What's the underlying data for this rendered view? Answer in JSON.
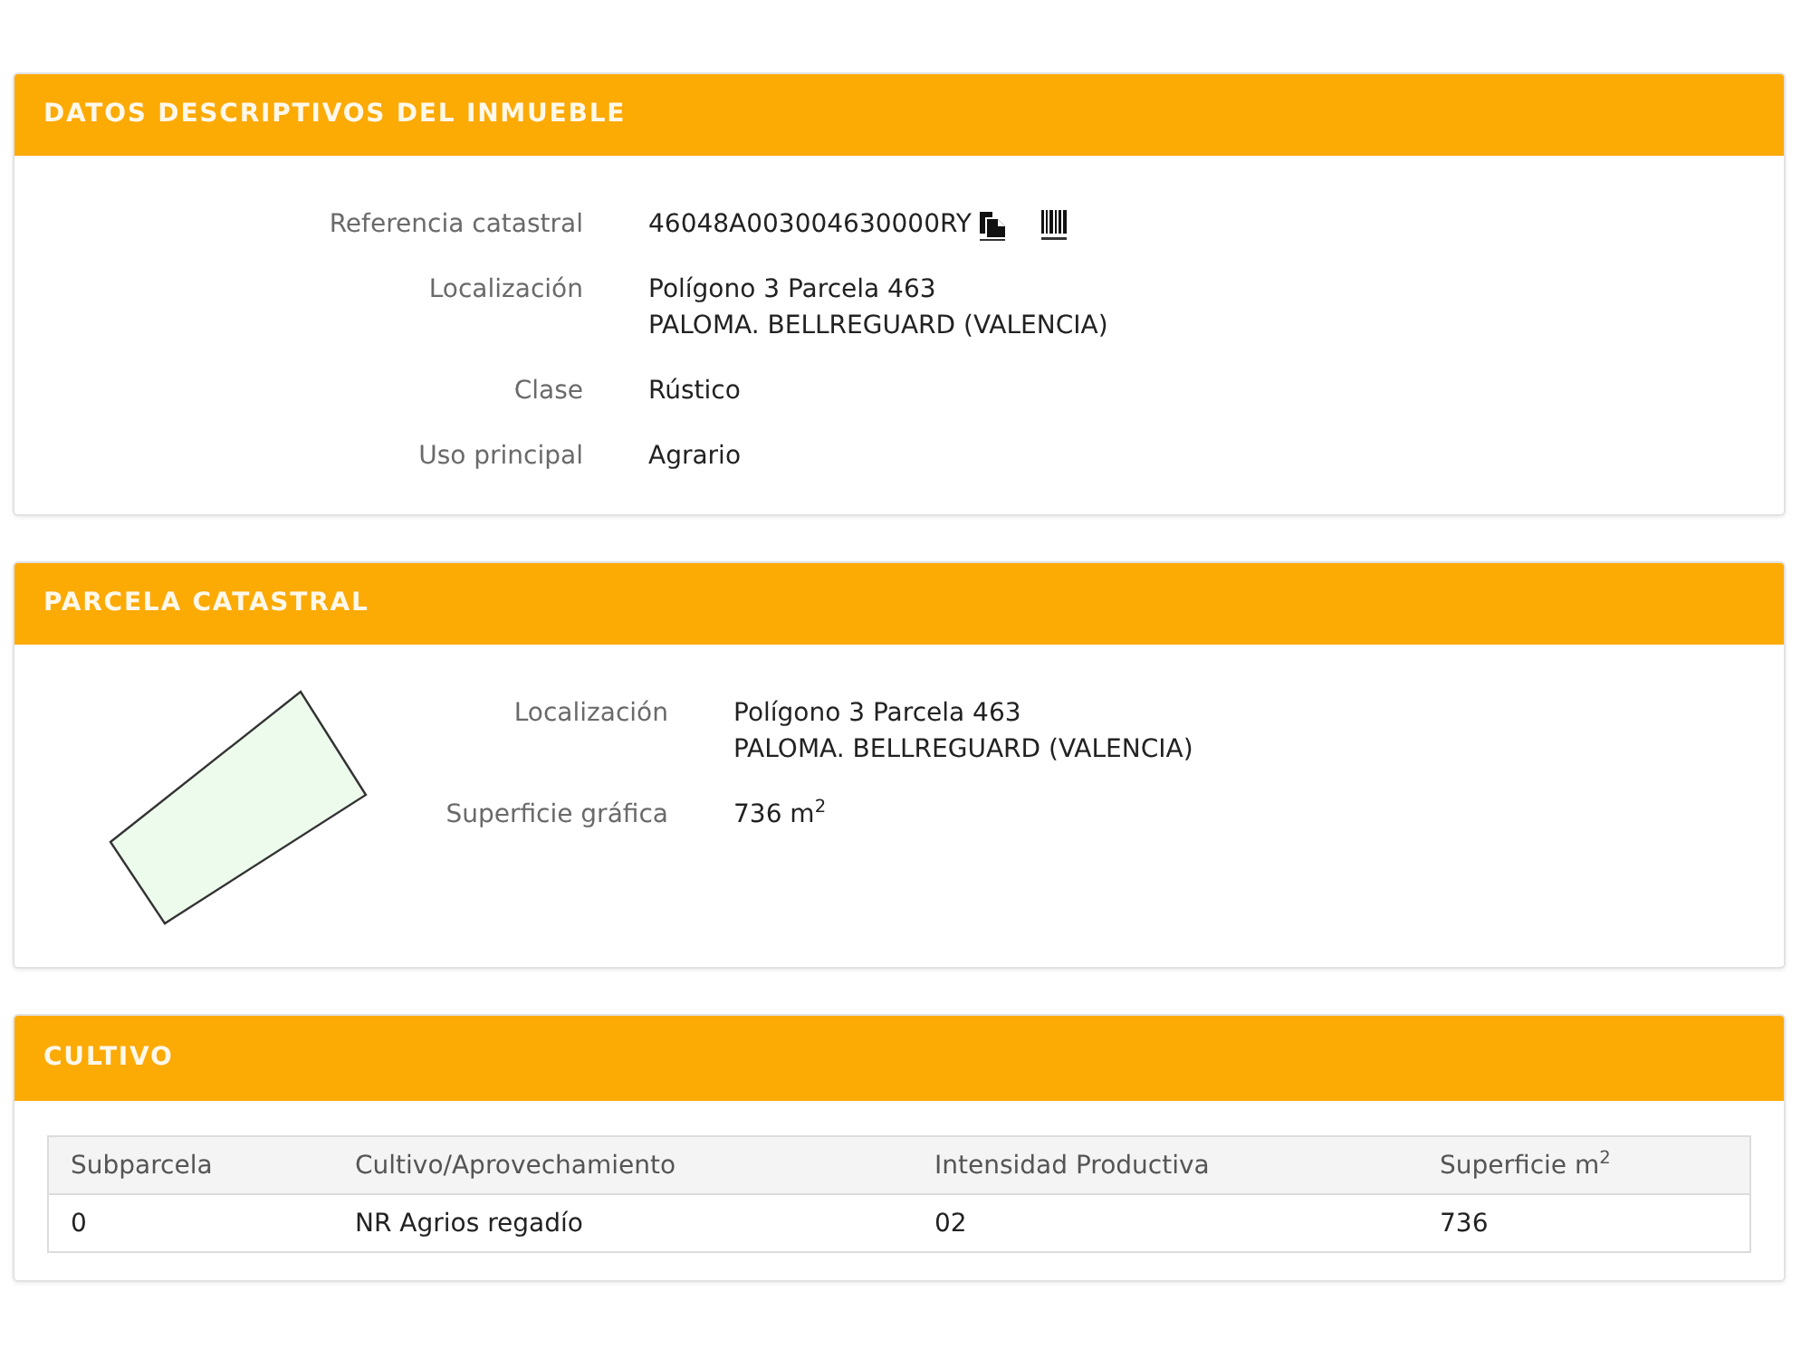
{
  "inmueble": {
    "title": "DATOS DESCRIPTIVOS DEL INMUEBLE",
    "fields": [
      {
        "kind": "reference",
        "label": "Referencia catastral",
        "lines": [
          "46048A003004630000RY"
        ]
      },
      {
        "kind": "text",
        "label": "Localización",
        "lines": [
          "Polígono 3 Parcela 463",
          "PALOMA. BELLREGUARD (VALENCIA)"
        ]
      },
      {
        "kind": "text",
        "label": "Clase",
        "lines": [
          "Rústico"
        ]
      },
      {
        "kind": "text",
        "label": "Uso principal",
        "lines": [
          "Agrario"
        ]
      }
    ]
  },
  "parcela": {
    "title": "PARCELA CATASTRAL",
    "fields": [
      {
        "label": "Localización",
        "lines": [
          "Polígono 3 Parcela 463",
          "PALOMA. BELLREGUARD (VALENCIA)"
        ]
      },
      {
        "label": "Superficie gráfica",
        "lines": [
          "736 m$^{2}$"
        ]
      }
    ]
  },
  "cultivo": {
    "title": "CULTIVO",
    "table": {
      "columns": [
        "Subparcela",
        "Cultivo/Aprovechamiento",
        "Intensidad Productiva",
        "Superficie m$^{2}$"
      ],
      "rows": [
        [
          "0",
          "NR Agrios regadío",
          "02",
          "736"
        ]
      ]
    }
  }
}
